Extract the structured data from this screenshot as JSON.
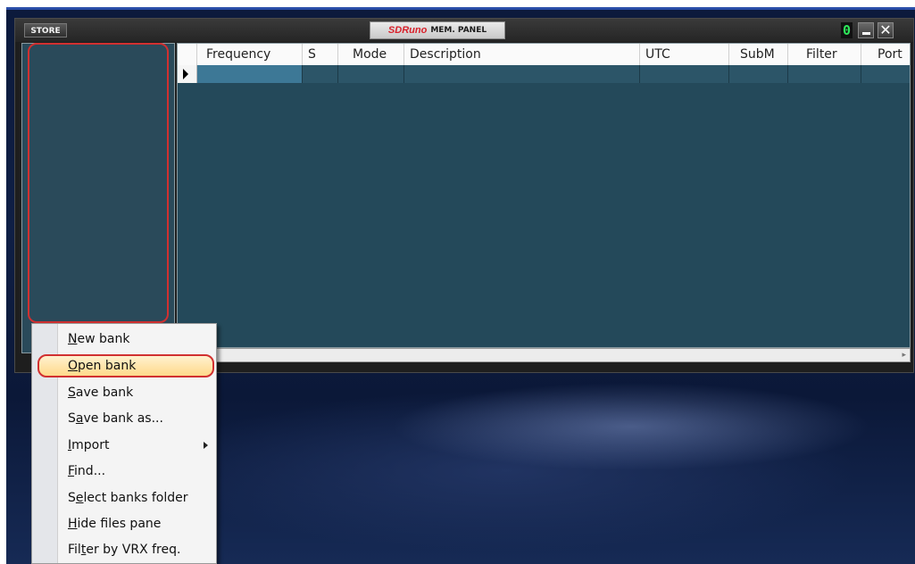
{
  "window": {
    "store_label": "STORE",
    "brand": "SDRuno",
    "panel_title": "MEM. PANEL",
    "digit": "0",
    "minimize_icon": "minimize-icon",
    "close_icon": "close-icon",
    "close_glyph": "✕"
  },
  "grid": {
    "columns": [
      "Frequency",
      "S",
      "Mode",
      "Description",
      "UTC",
      "SubM",
      "Filter",
      "Port"
    ]
  },
  "menu": {
    "items": [
      {
        "before": "",
        "key": "N",
        "after": "ew bank",
        "submenu": false
      },
      {
        "before": "",
        "key": "O",
        "after": "pen bank",
        "submenu": false
      },
      {
        "before": "",
        "key": "S",
        "after": "ave bank",
        "submenu": false
      },
      {
        "before": "S",
        "key": "a",
        "after": "ve bank as...",
        "submenu": false
      },
      {
        "before": "",
        "key": "I",
        "after": "mport",
        "submenu": true
      },
      {
        "before": "",
        "key": "F",
        "after": "ind...",
        "submenu": false
      },
      {
        "before": "S",
        "key": "e",
        "after": "lect banks folder",
        "submenu": false
      },
      {
        "before": "",
        "key": "H",
        "after": "ide files pane",
        "submenu": false
      },
      {
        "before": "Fil",
        "key": "t",
        "after": "er by VRX freq.",
        "submenu": false
      }
    ],
    "highlighted_index": 1
  },
  "colors": {
    "brand_red": "#d8202a",
    "highlight_ring": "#d13030",
    "digit_green": "#2ee85a"
  }
}
